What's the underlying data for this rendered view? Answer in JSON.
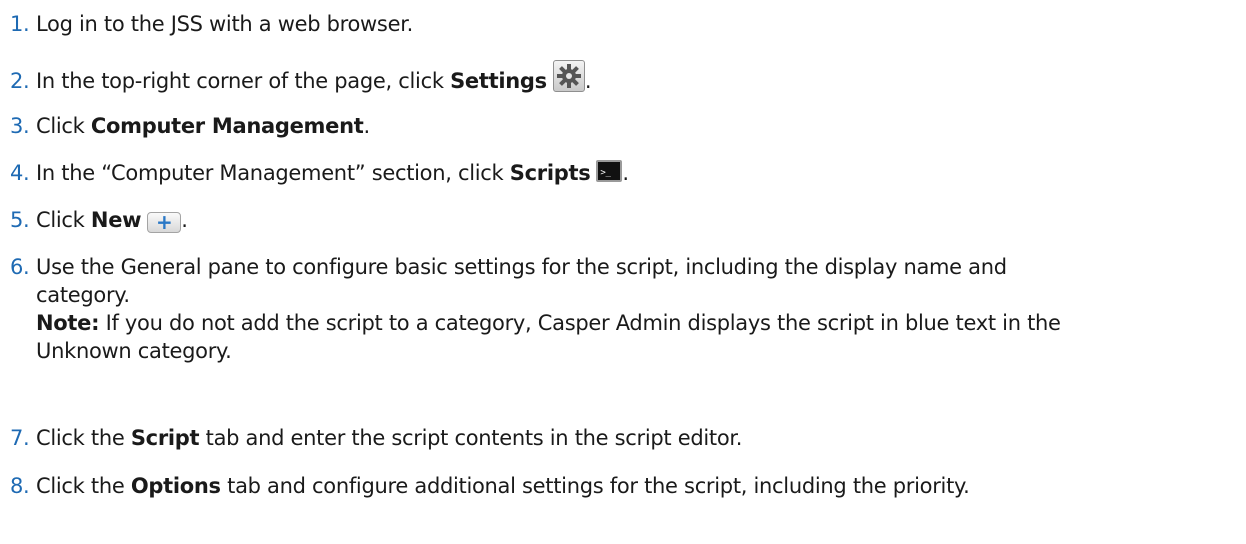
{
  "steps": [
    {
      "number": "1.",
      "text": "Log in to the JSS with a web browser."
    },
    {
      "number": "2.",
      "pre": "In the top-right corner of the page, click ",
      "bold": "Settings",
      "post": "."
    },
    {
      "number": "3.",
      "pre": "Click ",
      "bold": "Computer Management",
      "post": "."
    },
    {
      "number": "4.",
      "pre": "In the “Computer Management” section, click ",
      "bold": "Scripts",
      "post": "."
    },
    {
      "number": "5.",
      "pre": "Click ",
      "bold": "New",
      "post": "."
    },
    {
      "number": "6.",
      "line1": "Use the General pane to configure basic settings for the script, including the display name and",
      "line2": "category.",
      "note_label": "Note:",
      "note_text1": " If you do not add the script to a category, Casper Admin displays the script in blue text in the",
      "note_text2": "Unknown category."
    },
    {
      "number": "7.",
      "pre": "Click the ",
      "bold": "Script",
      "post": " tab and enter the script contents in the script editor."
    },
    {
      "number": "8.",
      "pre": "Click the ",
      "bold": "Options",
      "post": " tab and configure additional settings for the script, including the priority."
    }
  ],
  "icons": {
    "settings": "gear-icon",
    "scripts": "terminal-icon",
    "new": "plus-icon",
    "plus_glyph": "+"
  },
  "colors": {
    "step_number": "#1e6ab3",
    "text": "#1a1a1a"
  }
}
